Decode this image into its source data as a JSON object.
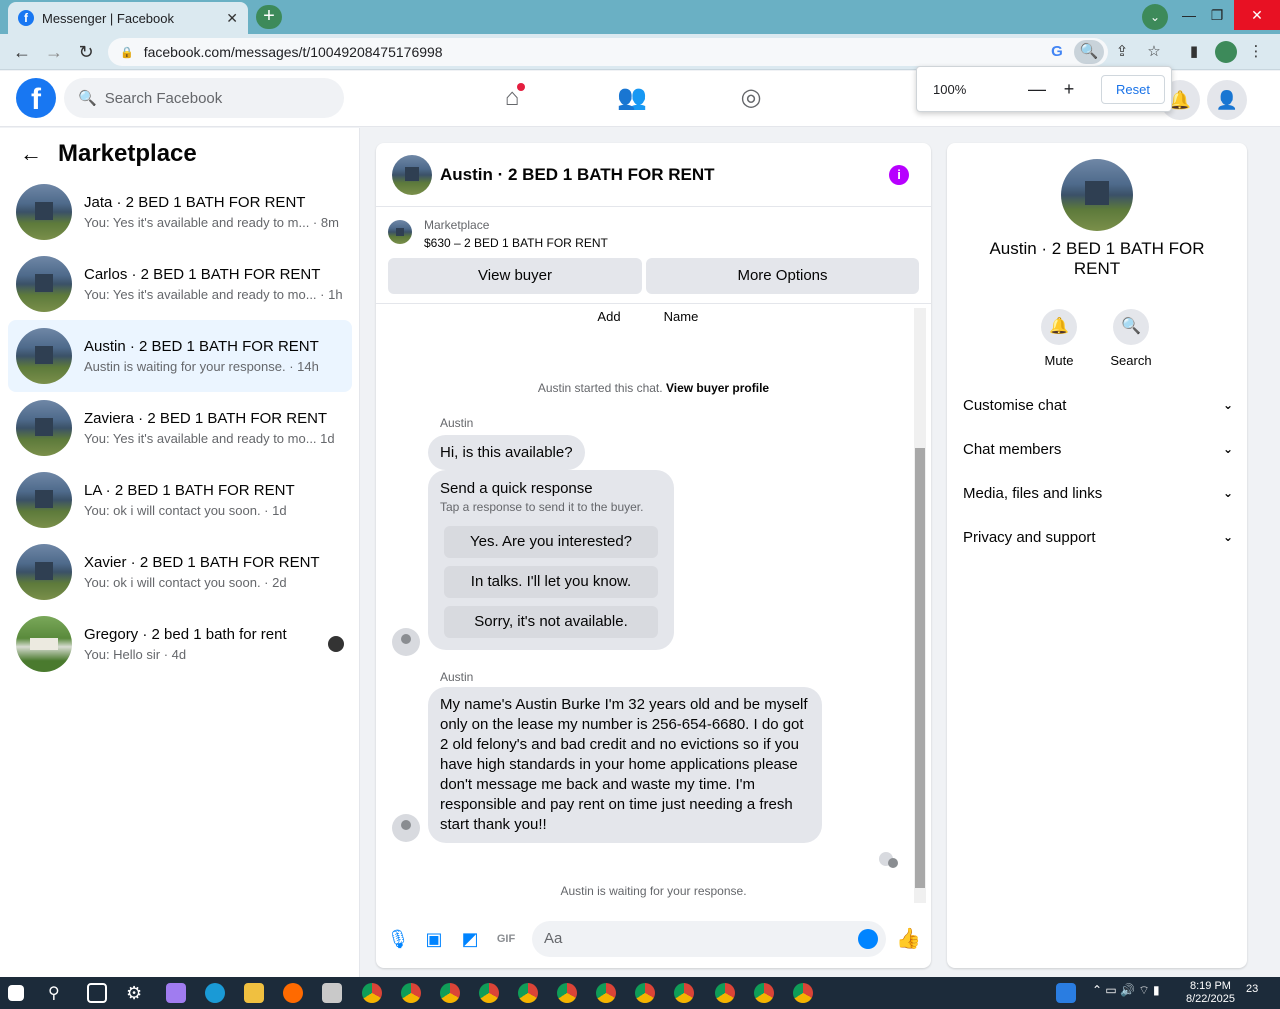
{
  "browser": {
    "tab_title": "Messenger | Facebook",
    "tab_close": "✕",
    "new_tab": "+",
    "url": "facebook.com/messages/t/10049208475176998",
    "zoom": {
      "value": "100%",
      "minus": "—",
      "plus": "+",
      "reset": "Reset"
    }
  },
  "fb": {
    "logo": "f",
    "search_placeholder": "Search Facebook"
  },
  "sidebar": {
    "title": "Marketplace",
    "conversations": [
      {
        "name": "Jata · 2 BED 1 BATH FOR RENT",
        "sub": "You: Yes it's available and ready to m... · 8m"
      },
      {
        "name": "Carlos · 2 BED 1 BATH FOR RENT",
        "sub": "You: Yes it's available and ready to mo... · 1h"
      },
      {
        "name": "Austin · 2 BED 1 BATH FOR RENT",
        "sub": "Austin is waiting for your response. · 14h"
      },
      {
        "name": "Zaviera · 2 BED 1 BATH FOR RENT",
        "sub": "You: Yes it's available and ready to mo... 1d"
      },
      {
        "name": "LA · 2 BED 1 BATH FOR RENT",
        "sub": "You: ok i will contact you soon. · 1d"
      },
      {
        "name": "Xavier · 2 BED 1 BATH FOR RENT",
        "sub": "You: ok i will contact you soon. · 2d"
      },
      {
        "name": "Gregory · 2 bed 1 bath for rent",
        "sub": "You: Hello sir · 4d"
      }
    ]
  },
  "chat": {
    "title": "Austin · 2 BED 1 BATH FOR RENT",
    "info_icon": "i",
    "marketplace_label": "Marketplace",
    "listing": "$630 – 2 BED 1 BATH FOR RENT",
    "view_buyer": "View buyer",
    "more_options": "More Options",
    "quick_add": "Add",
    "quick_name": "Name",
    "started_text": "Austin started this chat.",
    "view_buyer_profile": "View buyer profile",
    "sender1": "Austin",
    "msg1": "Hi, is this available?",
    "quick_response_title": "Send a quick response",
    "quick_response_sub": "Tap a response to send it to the buyer.",
    "quick_responses": [
      "Yes. Are you interested?",
      "In talks. I'll let you know.",
      "Sorry, it's not available."
    ],
    "sender2": "Austin",
    "msg2": "My name's Austin Burke I'm 32 years old and be myself only on the lease my number is 256-654-6680. I do got 2 old felony's and bad credit and no evictions so if you have high standards in your home applications please don't message me back and waste my time. I'm responsible and pay rent on time just needing a fresh start thank you!!",
    "waiting": "Austin is waiting for your response.",
    "composer_placeholder": "Aa"
  },
  "info": {
    "name": "Austin · 2 BED 1 BATH FOR RENT",
    "mute": "Mute",
    "search": "Search",
    "rows": [
      "Customise chat",
      "Chat members",
      "Media, files and links",
      "Privacy and support"
    ]
  },
  "taskbar": {
    "time": "8:19 PM",
    "date": "8/22/2025",
    "notif": "23"
  }
}
